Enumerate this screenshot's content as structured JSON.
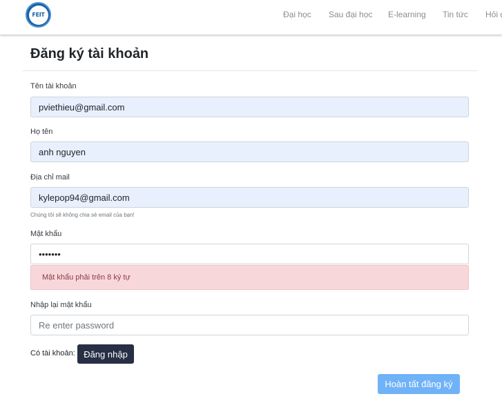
{
  "nav": {
    "logo_text": "FEIT",
    "items": [
      "Đại học",
      "Sau đại học",
      "E-learning",
      "Tin tức",
      "Hỏi đáp"
    ]
  },
  "page": {
    "title": "Đăng ký tài khoản"
  },
  "form": {
    "username": {
      "label": "Tên tài khoản",
      "value": "pviethieu@gmail.com"
    },
    "fullname": {
      "label": "Họ tên",
      "value": "anh nguyen"
    },
    "email": {
      "label": "Địa chỉ mail",
      "value": "kylepop94@gmail.com",
      "help": "Chúng tôi sẽ không chia sẻ email của bạn!"
    },
    "password": {
      "label": "Mật khẩu",
      "value": "1234567",
      "error": "Mật khẩu phải trên 8 ký tự"
    },
    "confirm": {
      "label": "Nhập lại mật khẩu",
      "placeholder": "Re enter password",
      "value": ""
    },
    "have_account_text": "Có tài khoản:",
    "login_label": "Đăng nhập",
    "submit_label": "Hoàn tất đăng ký"
  },
  "colors": {
    "autofill_bg": "#e8f0fe",
    "alert_bg": "#f8d7da",
    "login_button": "#272f45",
    "submit_button": "#70b2f8"
  }
}
